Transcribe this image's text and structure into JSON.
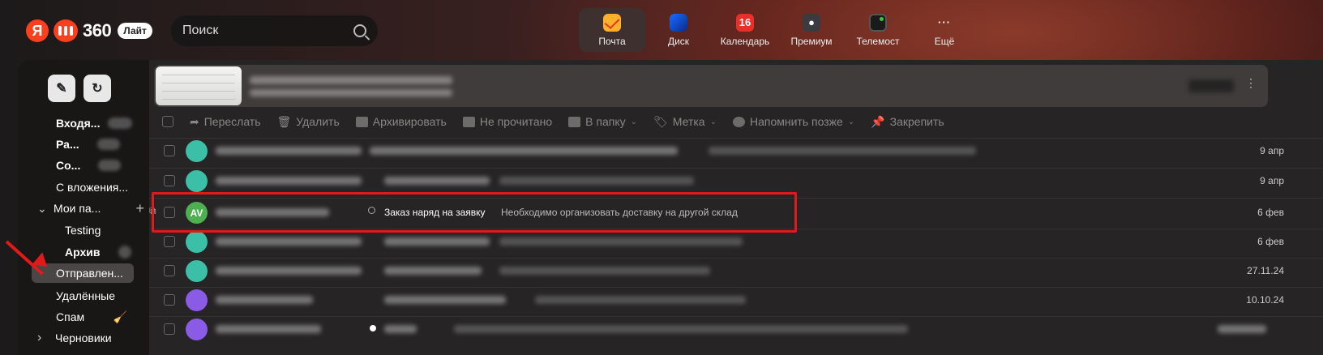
{
  "header": {
    "logo_ya": "Я",
    "logo_brand": "360",
    "logo_badge": "Лайт",
    "search_placeholder": "Поиск",
    "services": [
      {
        "label": "Почта",
        "icon": "mail-icon",
        "active": true
      },
      {
        "label": "Диск",
        "icon": "disk-icon"
      },
      {
        "label": "Календарь",
        "icon": "calendar-icon",
        "badge": "16"
      },
      {
        "label": "Премиум",
        "icon": "premium-icon"
      },
      {
        "label": "Телемост",
        "icon": "telemost-icon"
      },
      {
        "label": "Ещё",
        "icon": "more-icon",
        "glyph": "···"
      }
    ]
  },
  "sidebar": {
    "compose_icon": "compose-icon",
    "refresh_icon": "refresh-icon",
    "folders": [
      {
        "label": "Входя..."
      },
      {
        "label": "Ра..."
      },
      {
        "label": "Со..."
      },
      {
        "label": "С вложения..."
      },
      {
        "label": "Мои па...",
        "expand": "⌄",
        "add": "+"
      },
      {
        "label": "Testing"
      },
      {
        "label": "Архив"
      },
      {
        "label": "Отправлен...",
        "active": true
      },
      {
        "label": "Удалённые"
      },
      {
        "label": "Спам"
      },
      {
        "label": "Черновики",
        "expand": "›"
      }
    ]
  },
  "toolbar": {
    "items": [
      {
        "label": "Переслать",
        "icon": "forward-icon"
      },
      {
        "label": "Удалить",
        "icon": "trash-icon"
      },
      {
        "label": "Архивировать",
        "icon": "archive-icon"
      },
      {
        "label": "Не прочитано",
        "icon": "envelope-icon"
      },
      {
        "label": "В папку",
        "icon": "folder-icon",
        "chevron": "⌄"
      },
      {
        "label": "Метка",
        "icon": "tag-icon",
        "chevron": "⌄"
      },
      {
        "label": "Напомнить позже",
        "icon": "reminder-icon",
        "chevron": "⌄"
      },
      {
        "label": "Закрепить",
        "icon": "pin-icon"
      }
    ]
  },
  "messages": [
    {
      "date": "9 апр",
      "avatar_color": "#3bbfa6"
    },
    {
      "date": "9 апр",
      "avatar_color": "#3bbfa6"
    },
    {
      "date": "6 фев",
      "avatar_color": "#4caf50",
      "initials": "AV",
      "subject": "Заказ наряд на заявку",
      "preview": "Необходимо организовать доставку на другой склад",
      "highlighted": true
    },
    {
      "date": "6 фев",
      "avatar_color": "#3bbfa6"
    },
    {
      "date": "27.11.24",
      "avatar_color": "#3bbfa6"
    },
    {
      "date": "10.10.24",
      "avatar_color": "#8a5ce6"
    },
    {
      "date": "",
      "avatar_color": "#8a5ce6"
    }
  ],
  "colors": {
    "accent_red": "#e01a1a",
    "highlight_border": "#e01a1a",
    "mail_icon": "#ffb02e",
    "calendar_icon": "#e8302a"
  }
}
